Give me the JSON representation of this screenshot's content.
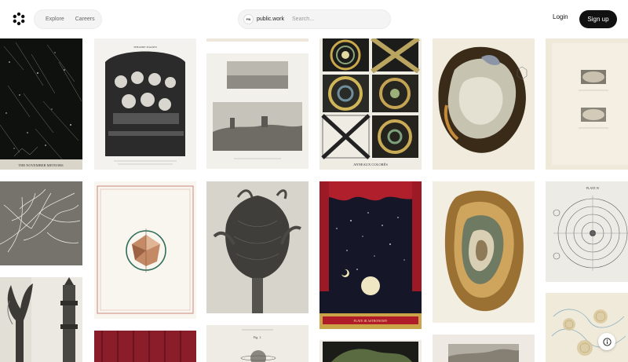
{
  "header": {
    "nav": {
      "explore_label": "Explore",
      "careers_label": "Careers"
    },
    "search": {
      "badge": "PW",
      "brand": "public.work",
      "placeholder": "Search..."
    },
    "login_label": "Login",
    "signup_label": "Sign up"
  },
  "gallery": {
    "captions": {
      "meteor": "THE NOVEMBER METEORS",
      "theatre_title": "THEATRE ITALIEN",
      "anneaux": "ANNEAUX COLORÉS",
      "cosmos": "PLATE III ASTRONOMY",
      "plate": "PLATE W"
    }
  },
  "colors": {
    "accent": "#111111",
    "header_bg": "#ffffff",
    "pill_bg": "#f4f4f4"
  }
}
